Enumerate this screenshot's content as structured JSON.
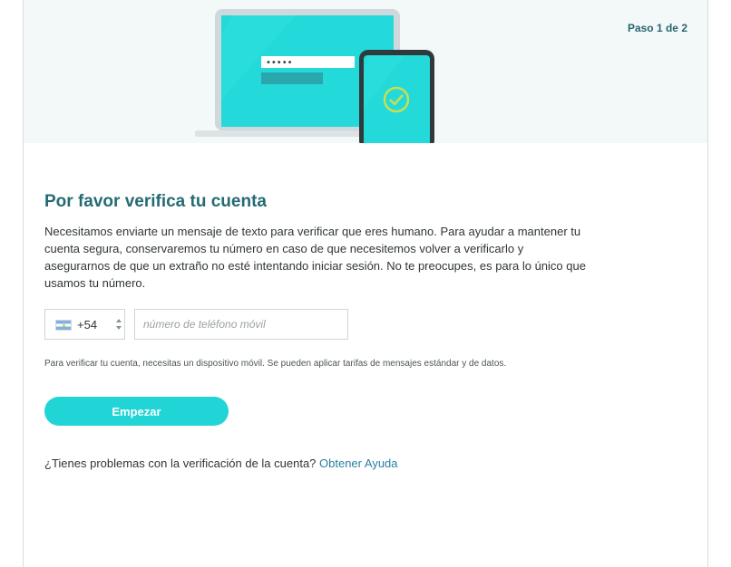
{
  "header": {
    "step_text": "Paso 1 de 2"
  },
  "illustration": {
    "password_mask": "•••••",
    "colors": {
      "screen": "#23d9da",
      "frame": "#cfd8db",
      "phone": "#2f3a3c",
      "check": "#c7e04f"
    }
  },
  "main": {
    "title": "Por favor verifica tu cuenta",
    "description": "Necesitamos enviarte un mensaje de texto para verificar que eres humano. Para ayudar a mantener tu cuenta segura, conservaremos tu número en caso de que necesitemos volver a verificarlo y asegurarnos de que un extraño no esté intentando iniciar sesión. No te preocupes, es para lo único que usamos tu número."
  },
  "phone": {
    "country_flag": "argentina-flag-icon",
    "country_code": "+54",
    "placeholder": "número de teléfono móvil",
    "value": ""
  },
  "note": "Para verificar tu cuenta, necesitas un dispositivo móvil. Se pueden aplicar tarifas de mensajes estándar y de datos.",
  "start_button": "Empezar",
  "help": {
    "text": "¿Tienes problemas con la verificación de la cuenta? ",
    "link": "Obtener Ayuda"
  },
  "theme": {
    "accent": "#21d4d6",
    "title_color": "#256b73",
    "link_color": "#2c7ea5"
  }
}
